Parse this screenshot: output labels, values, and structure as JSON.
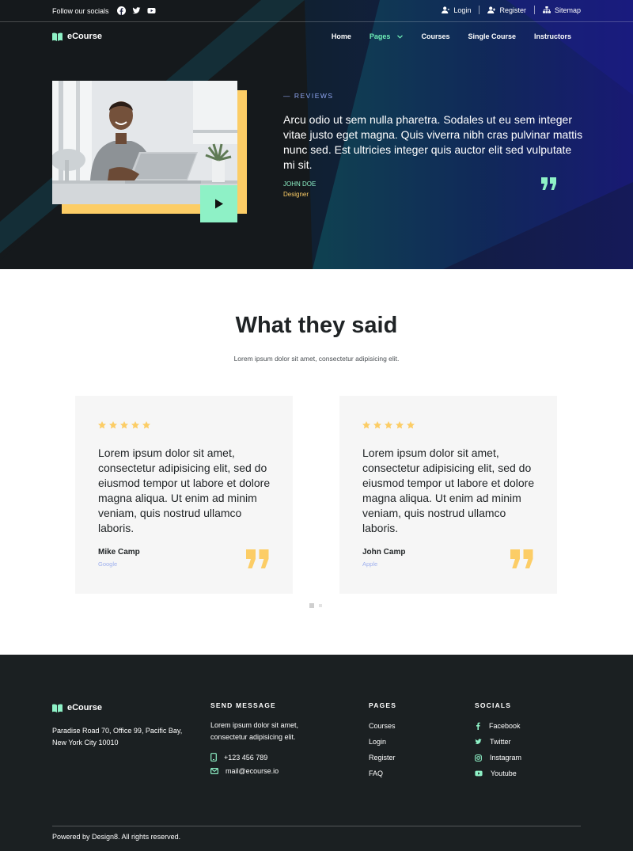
{
  "topbar": {
    "follow_label": "Follow our socials",
    "social_icons": [
      "facebook-icon",
      "twitter-icon",
      "youtube-icon"
    ],
    "links": [
      {
        "label": "Login",
        "icon": "user-icon"
      },
      {
        "label": "Register",
        "icon": "user-plus-icon"
      },
      {
        "label": "Sitemap",
        "icon": "sitemap-icon"
      }
    ]
  },
  "brand": {
    "name": "eCourse",
    "icon": "book-icon"
  },
  "nav": {
    "items": [
      {
        "label": "Home",
        "active": false
      },
      {
        "label": "Pages",
        "active": true,
        "dropdown": true
      },
      {
        "label": "Courses",
        "active": false
      },
      {
        "label": "Single Course",
        "active": false
      },
      {
        "label": "Instructors",
        "active": false
      }
    ]
  },
  "hero": {
    "eyebrow": "— REVIEWS",
    "quote": "Arcu odio ut sem nulla pharetra. Sodales ut eu sem integer vitae justo eget magna. Quis viverra nibh cras pulvinar mattis nunc sed. Est ultricies integer quis auctor elit sed vulputate mi sit.",
    "author": "JOHN DOE",
    "role": "Designer",
    "play_icon": "play-icon"
  },
  "testimonials": {
    "title": "What they said",
    "subtitle": "Lorem ipsum dolor sit amet, consectetur adipisicing elit.",
    "cards": [
      {
        "rating": 5,
        "text": "Lorem ipsum dolor sit amet, consectetur adipisicing elit, sed do eiusmod tempor ut labore et dolore magna aliqua. Ut enim ad minim veniam, quis nostrud ullamco laboris.",
        "author": "Mike Camp",
        "company": "Google"
      },
      {
        "rating": 5,
        "text": "Lorem ipsum dolor sit amet, consectetur adipisicing elit, sed do eiusmod tempor ut labore et dolore magna aliqua. Ut enim ad minim veniam, quis nostrud ullamco laboris.",
        "author": "John Camp",
        "company": "Apple"
      }
    ],
    "pagination": {
      "pages": 2,
      "current": 1
    }
  },
  "footer": {
    "brand": "eCourse",
    "address": "Paradise Road 70, Office 99, Pacific Bay,  New York City 10010",
    "send_message": {
      "heading": "SEND MESSAGE",
      "text": "Lorem ipsum dolor sit amet, consectetur adipisicing elit.",
      "phone": "+123 456 789",
      "email": "mail@ecourse.io"
    },
    "pages": {
      "heading": "PAGES",
      "links": [
        "Courses",
        "Login",
        "Register",
        "FAQ"
      ]
    },
    "socials": {
      "heading": "SOCIALS",
      "links": [
        {
          "label": "Facebook",
          "icon": "facebook-icon"
        },
        {
          "label": "Twitter",
          "icon": "twitter-icon"
        },
        {
          "label": "Instagram",
          "icon": "instagram-icon"
        },
        {
          "label": "Youtube",
          "icon": "youtube-icon"
        }
      ]
    },
    "copyright": "Powered by Design8. All rights reserved."
  },
  "colors": {
    "accent_green": "#8ef1c6",
    "accent_yellow": "#fccd66",
    "accent_blue": "#8fa6f2",
    "dark": "#1b2022",
    "hero_navy": "#1a1f6e"
  }
}
